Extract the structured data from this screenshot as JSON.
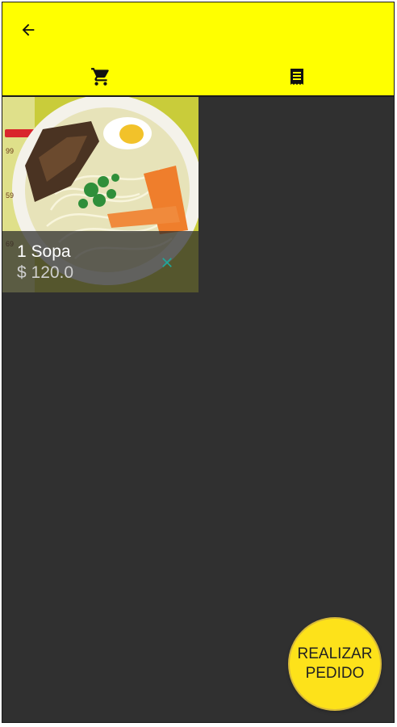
{
  "toolbar": {
    "back_icon": "arrow-back-icon",
    "background": "#ffff00"
  },
  "tabs": [
    {
      "icon": "shopping-cart-icon",
      "selected": true
    },
    {
      "icon": "receipt-list-icon",
      "selected": false
    }
  ],
  "cart": {
    "items": [
      {
        "title": "1 Sopa",
        "price": "$ 120.0",
        "image": "soup-bowl"
      }
    ]
  },
  "fab": {
    "label_line1": "REALIZAR",
    "label_line2": "PEDIDO",
    "color": "#fde21a"
  },
  "colors": {
    "content_background": "#303030",
    "remove_icon": "#1fa89a"
  }
}
